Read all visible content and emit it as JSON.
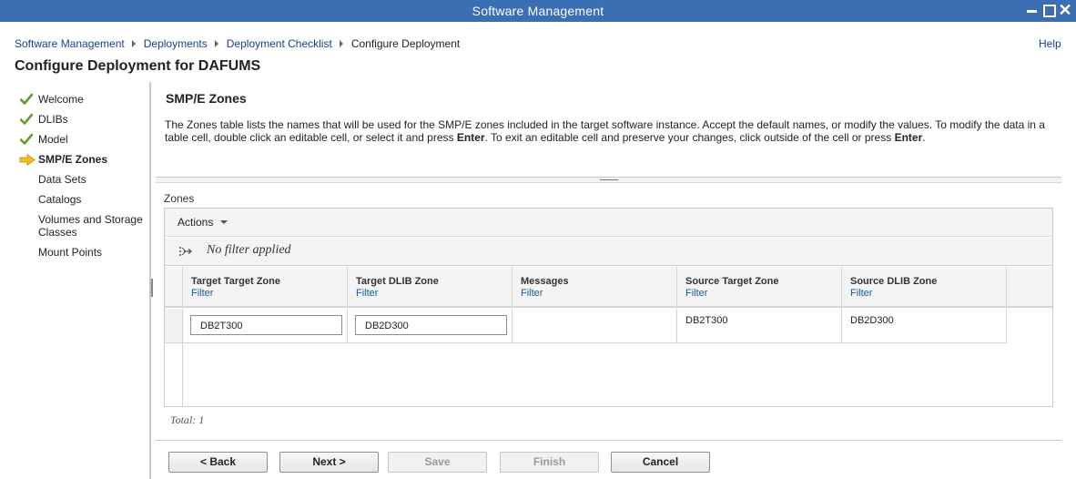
{
  "window": {
    "title": "Software Management"
  },
  "breadcrumb": {
    "items": [
      "Software Management",
      "Deployments",
      "Deployment Checklist"
    ],
    "current": "Configure Deployment"
  },
  "help_label": "Help",
  "page_title": "Configure Deployment for DAFUMS",
  "nav": {
    "items": [
      {
        "label": "Welcome",
        "state": "done"
      },
      {
        "label": "DLIBs",
        "state": "done"
      },
      {
        "label": "Model",
        "state": "done"
      },
      {
        "label": "SMP/E Zones",
        "state": "current"
      },
      {
        "label": "Data Sets",
        "state": "todo"
      },
      {
        "label": "Catalogs",
        "state": "todo"
      },
      {
        "label": "Volumes and Storage Classes",
        "state": "todo"
      },
      {
        "label": "Mount Points",
        "state": "todo"
      }
    ]
  },
  "section": {
    "title": "SMP/E Zones",
    "instructions": {
      "part1": "The Zones table lists the names that will be used for the SMP/E zones included in the target software instance.  Accept the default names, or modify the values. To modify the data in a table cell, double click an editable cell, or select it and press ",
      "key1": "Enter",
      "part2": ".  To exit an editable cell and preserve your changes, click outside of the cell or press ",
      "key2": "Enter",
      "part3": "."
    }
  },
  "table": {
    "label": "Zones",
    "actions_label": "Actions",
    "filter_status": "No filter applied",
    "filter_link": "Filter",
    "columns": [
      "Target Target Zone",
      "Target DLIB Zone",
      "Messages",
      "Source Target Zone",
      "Source DLIB Zone"
    ],
    "rows": [
      {
        "target_target_zone": "DB2T300",
        "target_dlib_zone": "DB2D300",
        "messages": "",
        "source_target_zone": "DB2T300",
        "source_dlib_zone": "DB2D300"
      }
    ],
    "total": "Total: 1"
  },
  "buttons": {
    "back": "< Back",
    "next": "Next >",
    "save": "Save",
    "finish": "Finish",
    "cancel": "Cancel"
  },
  "colors": {
    "titlebar": "#3c6eb4",
    "link": "#1a3f8a",
    "check": "#5aa02c",
    "arrow": "#f2c21b"
  }
}
